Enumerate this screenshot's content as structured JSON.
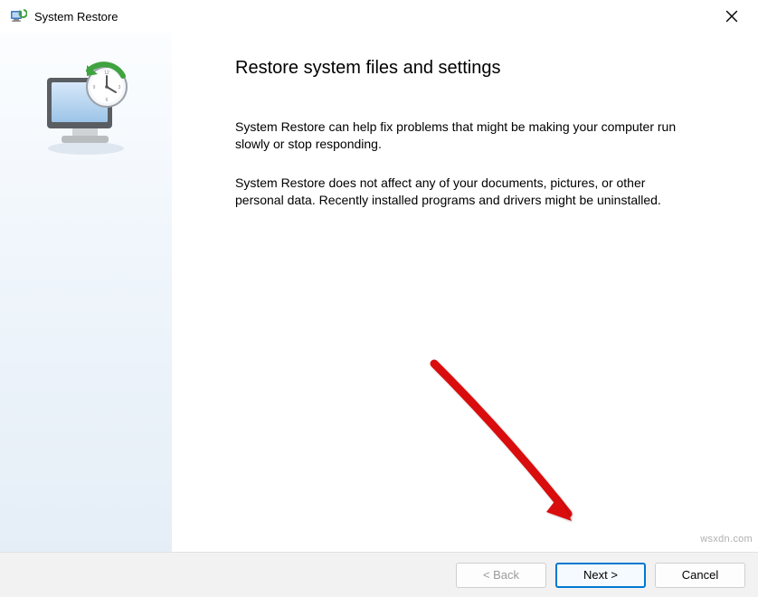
{
  "titlebar": {
    "title": "System Restore"
  },
  "main": {
    "heading": "Restore system files and settings",
    "paragraph1": "System Restore can help fix problems that might be making your computer run slowly or stop responding.",
    "paragraph2": "System Restore does not affect any of your documents, pictures, or other personal data. Recently installed programs and drivers might be uninstalled."
  },
  "footer": {
    "back_label": "< Back",
    "next_label": "Next >",
    "cancel_label": "Cancel"
  },
  "watermark": "wsxdn.com"
}
